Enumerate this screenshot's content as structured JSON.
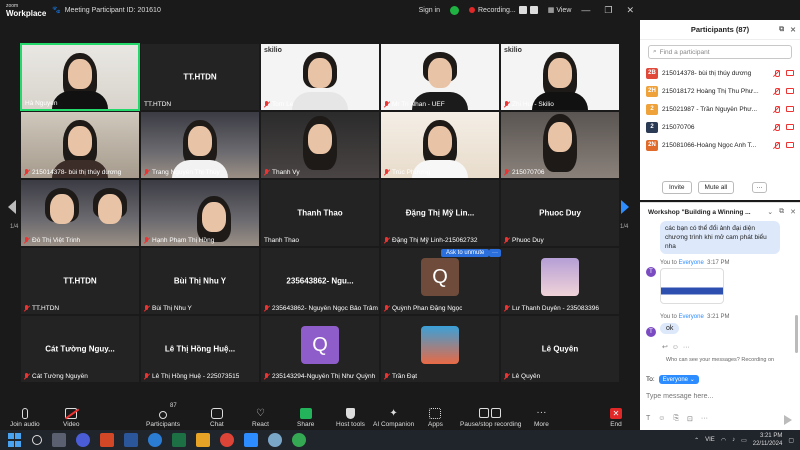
{
  "topbar": {
    "logo_line1": "zoom",
    "logo_line2": "Workplace",
    "meeting_id": "Meeting Participant ID: 201610",
    "signin": "Sign in",
    "recording": "Recording...",
    "view": "View"
  },
  "grid": {
    "tiles": [
      {
        "label": "Hà Nguyen",
        "center": ""
      },
      {
        "label": "TT.HTDN",
        "center": "TT.HTDN"
      },
      {
        "label": "Tom Le",
        "center": ""
      },
      {
        "label": "Mr Tri Nhan - UEF",
        "center": ""
      },
      {
        "label": "Zhi Hui - Skilio",
        "center": ""
      },
      {
        "label": "215014378- bùi thị thúy dương",
        "center": ""
      },
      {
        "label": "Trang Nguyễn Thị Thùy",
        "center": ""
      },
      {
        "label": "Thanh Vy",
        "center": ""
      },
      {
        "label": "Trúc Phương",
        "center": ""
      },
      {
        "label": "215070706",
        "center": ""
      },
      {
        "label": "Đỗ Thị Việt Trinh",
        "center": ""
      },
      {
        "label": "Hạnh Phạm Thị Hồng",
        "center": ""
      },
      {
        "label": "Thanh Thao",
        "center": "Thanh Thao"
      },
      {
        "label": "Đặng Thị Mỹ Linh-215062732",
        "center": "Đặng Thị Mỹ Lin..."
      },
      {
        "label": "Phuoc Duy",
        "center": "Phuoc Duy"
      },
      {
        "label": "TT.HTDN",
        "center": "TT.HTDN"
      },
      {
        "label": "Bùi Thị Nhu Y",
        "center": "Bùi Thị Nhu Y"
      },
      {
        "label": "235643862- Nguyễn Ngọc Bảo Trâm",
        "center": "235643862- Ngu..."
      },
      {
        "label": "Quỳnh Phan Đặng Ngọc",
        "center": ""
      },
      {
        "label": "Lư Thanh Duyên - 235083396",
        "center": ""
      },
      {
        "label": "Cát Tường Nguyễn",
        "center": "Cát Tường Nguy..."
      },
      {
        "label": "Lê Thị Hồng Huệ - 225073515",
        "center": "Lê Thị Hồng Huệ..."
      },
      {
        "label": "235143294-Nguyễn Thị Như Quỳnh",
        "center": ""
      },
      {
        "label": "Trần Đạt",
        "center": ""
      },
      {
        "label": "Lê Quyên",
        "center": "Lê Quyên"
      }
    ],
    "skilio_label": "skilio",
    "avatar_letter": "Q",
    "ask_unmute": "Ask to unmute",
    "ask_more": "···",
    "page_left": "1/4",
    "page_right": "1/4"
  },
  "toolbar": {
    "join_audio": "Join audio",
    "video": "Video",
    "participants": "Participants",
    "participants_count": "87",
    "chat": "Chat",
    "react": "React",
    "share": "Share",
    "host_tools": "Host tools",
    "ai_companion": "AI Companion",
    "apps": "Apps",
    "pause_rec": "Pause/stop recording",
    "more": "More",
    "end": "End"
  },
  "participants_panel": {
    "title": "Participants (87)",
    "search_placeholder": "Find a participant",
    "rows": [
      {
        "badge": "2B",
        "color": "#e0483a",
        "name": "215014378- bùi thị thúy dương"
      },
      {
        "badge": "2H",
        "color": "#f0a23a",
        "name": "215018172 Hoàng Thị Thu Phư..."
      },
      {
        "badge": "2",
        "color": "#f0a23a",
        "name": "215021987 - Trần Nguyễn Phư..."
      },
      {
        "badge": "2",
        "color": "#2b3a55",
        "name": "215070706"
      },
      {
        "badge": "2N",
        "color": "#e06a2a",
        "name": "215081066-Hoàng Ngọc Anh T..."
      }
    ],
    "invite": "Invite",
    "mute_all": "Mute all",
    "more": "···"
  },
  "chat": {
    "title": "Workshop \"Building a Winning ...",
    "bubble_top": "các bạn có thể đổi ảnh đại diện chương trình khi mở cam phát biểu nha",
    "msg1_from": "You to",
    "msg1_to": "Everyone",
    "msg1_time": "3:17 PM",
    "msg2_from": "You to",
    "msg2_to": "Everyone",
    "msg2_time": "3:21 PM",
    "msg2_text": "ok",
    "avatar": "T",
    "who_can_see": "Who can see your messages? Recording on",
    "to_label": "To:",
    "to_value": "Everyone",
    "input_placeholder": "Type message here..."
  },
  "taskbar": {
    "lang": "VIE",
    "time": "3:21 PM",
    "date": "22/11/2024"
  }
}
